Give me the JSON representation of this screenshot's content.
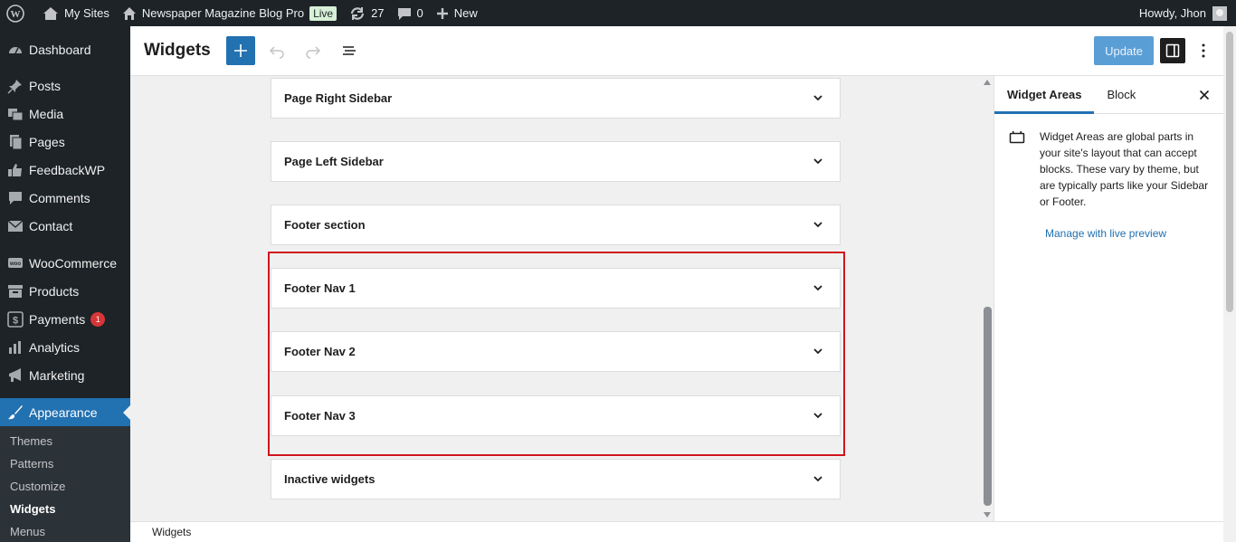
{
  "adminbar": {
    "my_sites": "My Sites",
    "site_name": "Newspaper Magazine Blog Pro",
    "live": "Live",
    "updates_count": "27",
    "comments_count": "0",
    "new": "New",
    "howdy": "Howdy, Jhon"
  },
  "sidebar": {
    "items": [
      {
        "label": "Dashboard",
        "icon": "dashboard-icon"
      },
      {
        "label": "Posts",
        "icon": "pin-icon"
      },
      {
        "label": "Media",
        "icon": "media-icon"
      },
      {
        "label": "Pages",
        "icon": "pages-icon"
      },
      {
        "label": "FeedbackWP",
        "icon": "thumbs-up-icon"
      },
      {
        "label": "Comments",
        "icon": "comment-icon"
      },
      {
        "label": "Contact",
        "icon": "mail-icon"
      },
      {
        "label": "WooCommerce",
        "icon": "woo-icon"
      },
      {
        "label": "Products",
        "icon": "archive-icon"
      },
      {
        "label": "Payments",
        "icon": "dollar-icon",
        "badge": "1"
      },
      {
        "label": "Analytics",
        "icon": "bar-chart-icon"
      },
      {
        "label": "Marketing",
        "icon": "megaphone-icon"
      },
      {
        "label": "Appearance",
        "icon": "brush-icon"
      }
    ],
    "submenu": [
      "Themes",
      "Patterns",
      "Customize",
      "Widgets",
      "Menus"
    ]
  },
  "header": {
    "title": "Widgets",
    "update": "Update"
  },
  "widget_areas": [
    "Page Right Sidebar",
    "Page Left Sidebar",
    "Footer section",
    "Footer Nav 1",
    "Footer Nav 2",
    "Footer Nav 3",
    "Inactive widgets"
  ],
  "panel": {
    "tab_widget_areas": "Widget Areas",
    "tab_block": "Block",
    "description": "Widget Areas are global parts in your site's layout that can accept blocks. These vary by theme, but are typically parts like your Sidebar or Footer.",
    "live_preview": "Manage with live preview"
  },
  "footer": {
    "breadcrumb": "Widgets"
  },
  "colors": {
    "accent": "#2271b1",
    "adminbar": "#1d2327",
    "highlight": "#d0151d"
  }
}
